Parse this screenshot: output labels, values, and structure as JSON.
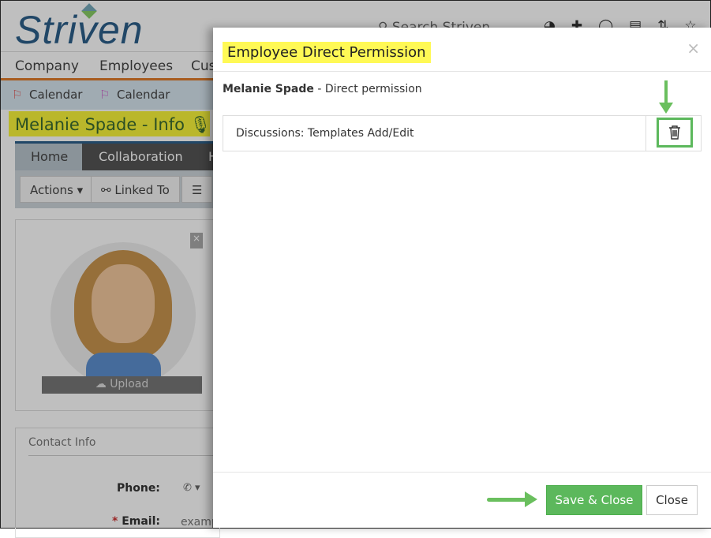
{
  "app": {
    "logo": "Striven",
    "search_placeholder": "Search Striven"
  },
  "nav": [
    "Company",
    "Employees",
    "Cus"
  ],
  "bookmarks": [
    "Calendar",
    "Calendar"
  ],
  "page": {
    "title": "Melanie Spade - Info",
    "tabs": [
      "Home",
      "Collaboration",
      "H"
    ],
    "toolbar": [
      "Actions",
      "Linked To"
    ],
    "upload": "Upload",
    "contact_header": "Contact Info",
    "phone_label": "Phone:",
    "email_label": "Email:",
    "email_value": "examp"
  },
  "modal": {
    "title": "Employee Direct Permission",
    "employee": "Melanie Spade",
    "subtitle": " - Direct permission",
    "permissions": [
      {
        "name": "Discussions: Templates Add/Edit"
      }
    ],
    "save_label": "Save & Close",
    "close_label": "Close",
    "close_x": "×"
  },
  "colors": {
    "highlight": "#fff955",
    "save": "#5cb85c",
    "annotation_arrow": "#6abf5e"
  }
}
